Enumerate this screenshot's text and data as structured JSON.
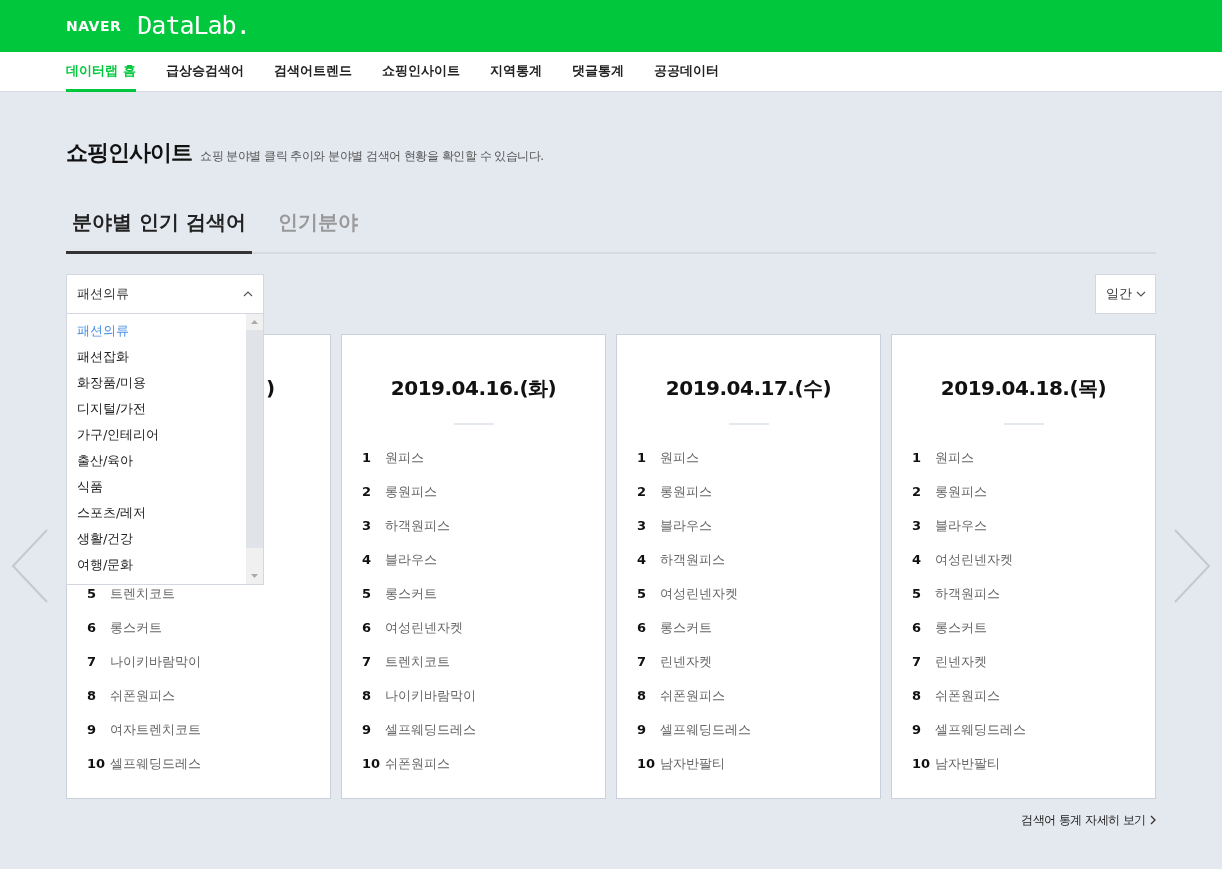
{
  "brand": {
    "naver": "NAVER",
    "product": "DataLab."
  },
  "nav": [
    {
      "label": "데이터랩 홈",
      "selected": true
    },
    {
      "label": "급상승검색어",
      "selected": false
    },
    {
      "label": "검색어트렌드",
      "selected": false
    },
    {
      "label": "쇼핑인사이트",
      "selected": false
    },
    {
      "label": "지역통계",
      "selected": false
    },
    {
      "label": "댓글통계",
      "selected": false
    },
    {
      "label": "공공데이터",
      "selected": false
    }
  ],
  "page": {
    "title": "쇼핑인사이트",
    "subtitle": "쇼핑 분야별 클릭 추이와 분야별 검색어 현황을 확인할 수 있습니다."
  },
  "tabs": [
    {
      "label": "분야별 인기 검색어",
      "selected": true
    },
    {
      "label": "인기분야",
      "selected": false
    }
  ],
  "category_select": {
    "value": "패션의류",
    "expanded": true,
    "options": [
      {
        "label": "패션의류",
        "selected": true
      },
      {
        "label": "패션잡화",
        "selected": false
      },
      {
        "label": "화장품/미용",
        "selected": false
      },
      {
        "label": "디지털/가전",
        "selected": false
      },
      {
        "label": "가구/인테리어",
        "selected": false
      },
      {
        "label": "출산/육아",
        "selected": false
      },
      {
        "label": "식품",
        "selected": false
      },
      {
        "label": "스포츠/레저",
        "selected": false
      },
      {
        "label": "생활/건강",
        "selected": false
      },
      {
        "label": "여행/문화",
        "selected": false
      }
    ]
  },
  "period_select": {
    "value": "일간"
  },
  "cards": [
    {
      "title": ")",
      "covered": true,
      "items": [
        {
          "rank": "5",
          "keyword": "트렌치코트"
        },
        {
          "rank": "6",
          "keyword": "롱스커트"
        },
        {
          "rank": "7",
          "keyword": "나이키바람막이"
        },
        {
          "rank": "8",
          "keyword": "쉬폰원피스"
        },
        {
          "rank": "9",
          "keyword": "여자트렌치코트"
        },
        {
          "rank": "10",
          "keyword": "셀프웨딩드레스"
        }
      ]
    },
    {
      "title": "2019.04.16.(화)",
      "covered": false,
      "items": [
        {
          "rank": "1",
          "keyword": "원피스"
        },
        {
          "rank": "2",
          "keyword": "롱원피스"
        },
        {
          "rank": "3",
          "keyword": "하객원피스"
        },
        {
          "rank": "4",
          "keyword": "블라우스"
        },
        {
          "rank": "5",
          "keyword": "롱스커트"
        },
        {
          "rank": "6",
          "keyword": "여성린넨자켓"
        },
        {
          "rank": "7",
          "keyword": "트렌치코트"
        },
        {
          "rank": "8",
          "keyword": "나이키바람막이"
        },
        {
          "rank": "9",
          "keyword": "셀프웨딩드레스"
        },
        {
          "rank": "10",
          "keyword": "쉬폰원피스"
        }
      ]
    },
    {
      "title": "2019.04.17.(수)",
      "covered": false,
      "items": [
        {
          "rank": "1",
          "keyword": "원피스"
        },
        {
          "rank": "2",
          "keyword": "롱원피스"
        },
        {
          "rank": "3",
          "keyword": "블라우스"
        },
        {
          "rank": "4",
          "keyword": "하객원피스"
        },
        {
          "rank": "5",
          "keyword": "여성린넨자켓"
        },
        {
          "rank": "6",
          "keyword": "롱스커트"
        },
        {
          "rank": "7",
          "keyword": "린넨자켓"
        },
        {
          "rank": "8",
          "keyword": "쉬폰원피스"
        },
        {
          "rank": "9",
          "keyword": "셀프웨딩드레스"
        },
        {
          "rank": "10",
          "keyword": "남자반팔티"
        }
      ]
    },
    {
      "title": "2019.04.18.(목)",
      "covered": false,
      "items": [
        {
          "rank": "1",
          "keyword": "원피스"
        },
        {
          "rank": "2",
          "keyword": "롱원피스"
        },
        {
          "rank": "3",
          "keyword": "블라우스"
        },
        {
          "rank": "4",
          "keyword": "여성린넨자켓"
        },
        {
          "rank": "5",
          "keyword": "하객원피스"
        },
        {
          "rank": "6",
          "keyword": "롱스커트"
        },
        {
          "rank": "7",
          "keyword": "린넨자켓"
        },
        {
          "rank": "8",
          "keyword": "쉬폰원피스"
        },
        {
          "rank": "9",
          "keyword": "셀프웨딩드레스"
        },
        {
          "rank": "10",
          "keyword": "남자반팔티"
        }
      ]
    }
  ],
  "more_link": "검색어 통계 자세히 보기"
}
